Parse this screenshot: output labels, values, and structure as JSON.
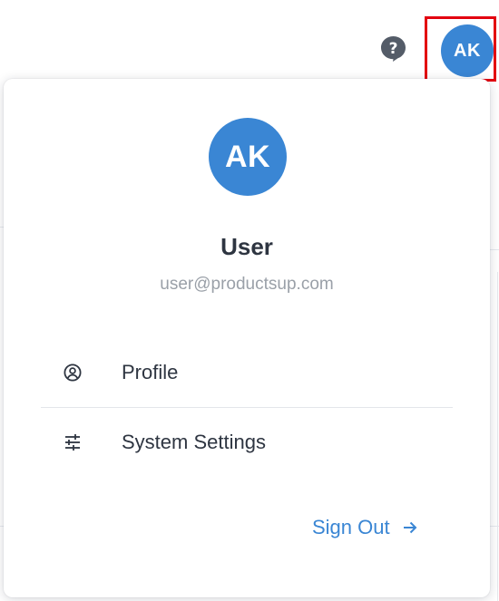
{
  "header": {
    "help_icon": "help-circle-icon",
    "avatar_initials": "AK",
    "avatar_color": "#3a86d4",
    "highlight_color": "#e3000f"
  },
  "user_menu": {
    "avatar_initials": "AK",
    "name": "User",
    "email": "user@productsup.com",
    "items": [
      {
        "label": "Profile",
        "icon": "user-circle-icon"
      },
      {
        "label": "System Settings",
        "icon": "sliders-icon"
      }
    ],
    "sign_out_label": "Sign Out",
    "accent_color": "#3a86d4"
  }
}
